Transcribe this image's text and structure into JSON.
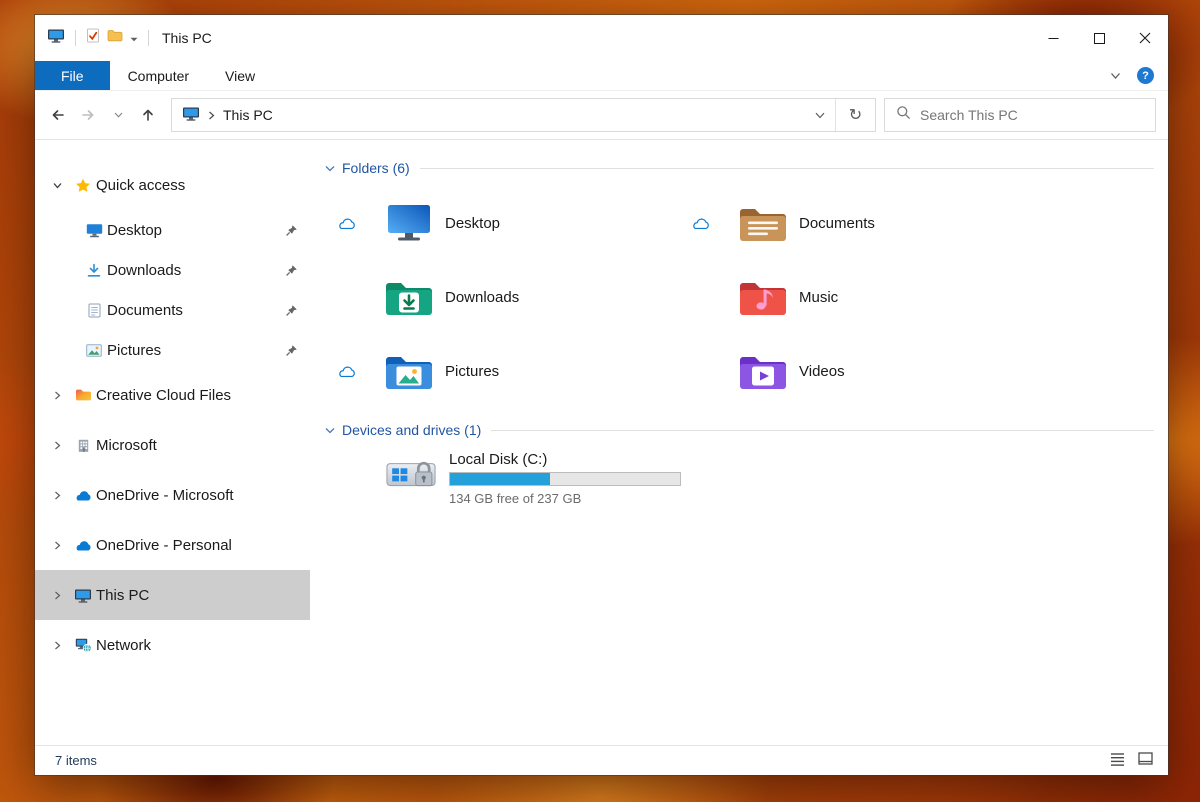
{
  "window": {
    "title": "This PC"
  },
  "icons": {
    "help_glyph": "?",
    "refresh_glyph": "↻"
  },
  "ribbon": {
    "tabs": [
      {
        "label": "File"
      },
      {
        "label": "Computer"
      },
      {
        "label": "View"
      }
    ]
  },
  "navbar": {
    "breadcrumb": "This PC",
    "search_placeholder": "Search This PC"
  },
  "sidebar": {
    "items": [
      {
        "label": "Quick access",
        "icon": "star-icon",
        "expanded": true
      },
      {
        "label": "Desktop",
        "icon": "desktop-icon",
        "pinned": true
      },
      {
        "label": "Downloads",
        "icon": "download-icon",
        "pinned": true
      },
      {
        "label": "Documents",
        "icon": "document-icon",
        "pinned": true
      },
      {
        "label": "Pictures",
        "icon": "picture-icon",
        "pinned": true
      },
      {
        "label": "Creative Cloud Files",
        "icon": "creative-cloud-icon"
      },
      {
        "label": "Microsoft",
        "icon": "building-icon"
      },
      {
        "label": "OneDrive - Microsoft",
        "icon": "onedrive-cloud-icon"
      },
      {
        "label": "OneDrive - Personal",
        "icon": "onedrive-cloud-icon"
      },
      {
        "label": "This PC",
        "icon": "computer-icon",
        "selected": true
      },
      {
        "label": "Network",
        "icon": "network-icon"
      }
    ]
  },
  "content": {
    "groups": [
      {
        "label": "Folders (6)"
      },
      {
        "label": "Devices and drives (1)"
      }
    ],
    "folders": [
      {
        "name": "Desktop",
        "cloud_status": true
      },
      {
        "name": "Documents",
        "cloud_status": true
      },
      {
        "name": "Downloads",
        "cloud_status": false
      },
      {
        "name": "Music",
        "cloud_status": false
      },
      {
        "name": "Pictures",
        "cloud_status": true
      },
      {
        "name": "Videos",
        "cloud_status": false
      }
    ],
    "drive": {
      "name": "Local Disk (C:)",
      "free_text": "134 GB free of 237 GB",
      "used_percent": 43.5
    }
  },
  "statusbar": {
    "items_count": "7 items"
  },
  "colors": {
    "accent": "#0078d7",
    "file_tab": "#0e6cbe",
    "sidebar_selection": "#cdcdcd",
    "disk_used_fill": "#26a0da",
    "group_header_text": "#2155a4"
  }
}
